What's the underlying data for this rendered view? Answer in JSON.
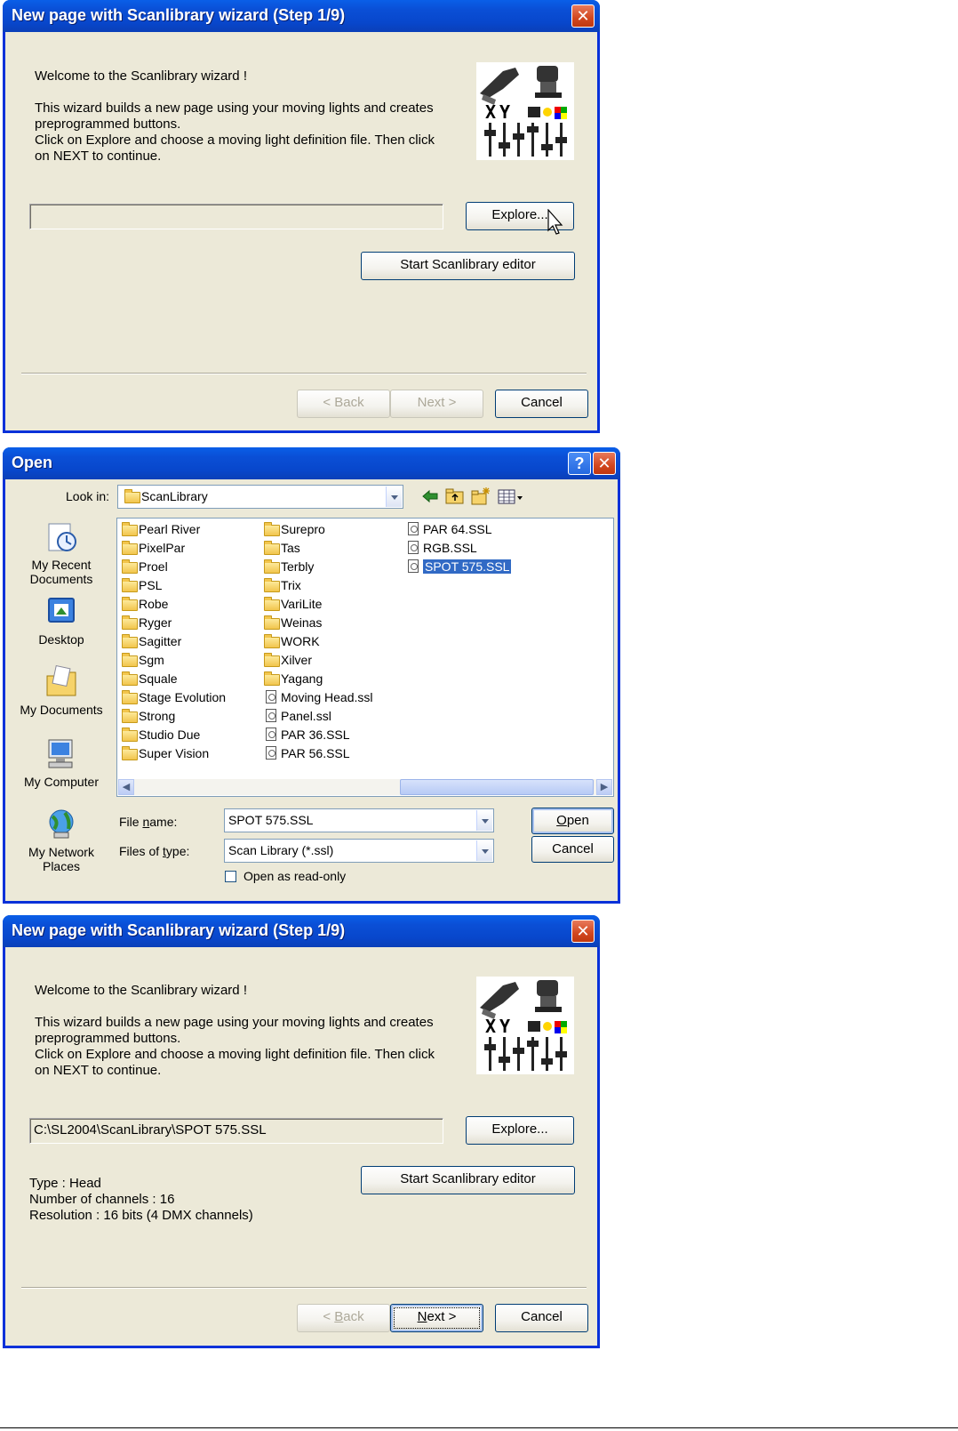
{
  "wizard1": {
    "title": "New page with Scanlibrary wizard (Step 1/9)",
    "close_glyph": "✕",
    "welcome": "Welcome to the Scanlibrary wizard !",
    "desc_line1": "This wizard builds a new page using your moving lights and creates",
    "desc_line2": "preprogrammed buttons.",
    "desc_line3": "Click on Explore and choose a moving light definition file. Then click",
    "desc_line4": "on NEXT to continue.",
    "path_value": "",
    "explore_label": "Explore...",
    "editor_label": "Start Scanlibrary editor",
    "back_label": "< Back",
    "next_label": "Next >",
    "cancel_label": "Cancel",
    "logo_text": "XY"
  },
  "open_dialog": {
    "title": "Open",
    "help_glyph": "?",
    "close_glyph": "✕",
    "look_in_label": "Look in:",
    "look_in_value": "ScanLibrary",
    "places": [
      {
        "line1": "My Recent",
        "line2": "Documents"
      },
      {
        "line1": "Desktop",
        "line2": ""
      },
      {
        "line1": "My Documents",
        "line2": ""
      },
      {
        "line1": "My Computer",
        "line2": ""
      },
      {
        "line1": "My Network",
        "line2": "Places"
      }
    ],
    "col1": [
      "Pearl River",
      "PixelPar",
      "Proel",
      "PSL",
      "Robe",
      "Ryger",
      "Sagitter",
      "Sgm",
      "Squale",
      "Stage Evolution",
      "Strong",
      "Studio Due",
      "Super Vision"
    ],
    "col2_folders": [
      "Surepro",
      "Tas",
      "Terbly",
      "Trix",
      "VariLite",
      "Weinas",
      "WORK",
      "Xilver",
      "Yagang"
    ],
    "col2_files": [
      "Moving Head.ssl",
      "Panel.ssl",
      "PAR 36.SSL",
      "PAR 56.SSL"
    ],
    "col3_files": [
      "PAR 64.SSL",
      "RGB.SSL",
      "SPOT 575.SSL"
    ],
    "file_name_label": "File name:",
    "file_name_value": "SPOT 575.SSL",
    "file_type_label": "Files of type:",
    "file_type_value": "Scan Library (*.ssl)",
    "read_only_label": "Open as read-only",
    "open_label": "Open",
    "cancel_label": "Cancel"
  },
  "wizard2": {
    "title": "New page with Scanlibrary wizard (Step 1/9)",
    "close_glyph": "✕",
    "welcome": "Welcome to the Scanlibrary wizard !",
    "desc_line1": "This wizard builds a new page using your moving lights and creates",
    "desc_line2": "preprogrammed buttons.",
    "desc_line3": "Click on Explore and choose a moving light definition file. Then click",
    "desc_line4": "on NEXT to continue.",
    "path_value": "C:\\SL2004\\ScanLibrary\\SPOT 575.SSL",
    "explore_label": "Explore...",
    "editor_label": "Start Scanlibrary editor",
    "info_type": "Type : Head",
    "info_channels": "Number of channels : 16",
    "info_resolution": "Resolution : 16 bits (4 DMX channels)",
    "back_label": "< Back",
    "next_label": "Next >",
    "cancel_label": "Cancel",
    "logo_text": "XY"
  },
  "colors": {
    "titlebar": "#0a4fd6",
    "dialog_bg": "#ece9d8",
    "selection": "#316ac5",
    "close_red": "#d2471f"
  }
}
